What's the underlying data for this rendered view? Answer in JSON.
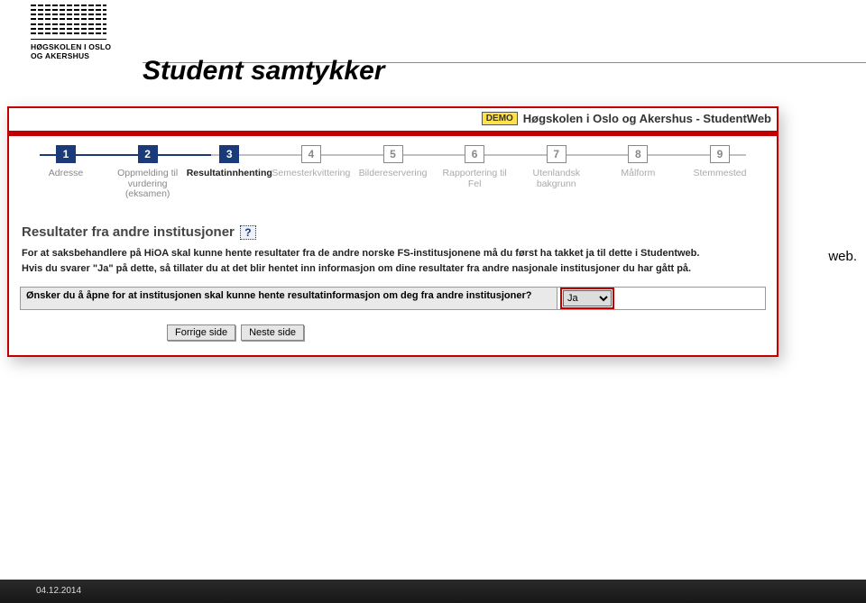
{
  "logo": {
    "line1": "HØGSKOLEN I OSLO",
    "line2": "OG AKERSHUS"
  },
  "page_title": "Student samtykker",
  "header": {
    "demo_label": "DEMO",
    "app_title": "Høgskolen i Oslo og Akershus - StudentWeb"
  },
  "steps": [
    {
      "num": "1",
      "label": "Adresse",
      "state": "active"
    },
    {
      "num": "2",
      "label": "Oppmelding til vurdering (eksamen)",
      "state": "active"
    },
    {
      "num": "3",
      "label": "Resultatinnhenting",
      "state": "current"
    },
    {
      "num": "4",
      "label": "Semesterkvittering",
      "state": ""
    },
    {
      "num": "5",
      "label": "Bildereservering",
      "state": ""
    },
    {
      "num": "6",
      "label": "Rapportering til Fel",
      "state": ""
    },
    {
      "num": "7",
      "label": "Utenlandsk bakgrunn",
      "state": ""
    },
    {
      "num": "8",
      "label": "Målform",
      "state": ""
    },
    {
      "num": "9",
      "label": "Stemmested",
      "state": ""
    }
  ],
  "section": {
    "title": "Resultater fra andre institusjoner",
    "info1": "For at saksbehandlere på HiOA skal kunne hente resultater fra de andre norske FS-institusjonene må du først ha takket ja til dette i Studentweb.",
    "info2": "Hvis du svarer \"Ja\" på dette, så tillater du at det blir hentet inn informasjon om dine resultater fra andre nasjonale institusjoner du har gått på.",
    "question": "Ønsker du å åpne for at institusjonen skal kunne hente resultatinformasjon om deg fra andre institusjoner?",
    "answer": "Ja"
  },
  "buttons": {
    "prev": "Forrige side",
    "next": "Neste side"
  },
  "fragment": "web.",
  "footer_date": "04.12.2014"
}
